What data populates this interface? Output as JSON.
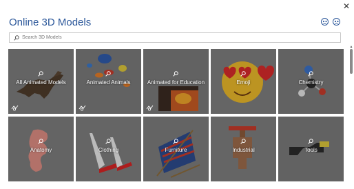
{
  "window": {
    "title": "Online 3D Models"
  },
  "search": {
    "placeholder": "Search 3D Models"
  },
  "categories": [
    {
      "label": "All Animated Models",
      "animated": true
    },
    {
      "label": "Animated Animals",
      "animated": true
    },
    {
      "label": "Animated for Education",
      "animated": true
    },
    {
      "label": "Emoji",
      "animated": false
    },
    {
      "label": "Chemistry",
      "animated": false
    },
    {
      "label": "Anatomy",
      "animated": false
    },
    {
      "label": "Clothing",
      "animated": false
    },
    {
      "label": "Furniture",
      "animated": false
    },
    {
      "label": "Industrial",
      "animated": false
    },
    {
      "label": "Tools",
      "animated": false
    }
  ],
  "icons": {
    "close": "close-icon",
    "happy": "smiley-happy-icon",
    "sad": "smiley-sad-icon",
    "search": "search-icon",
    "animated": "animated-model-icon"
  },
  "colors": {
    "title": "#2b579a",
    "accent": "#2b579a",
    "tile_bg": "#6e6e6e"
  }
}
